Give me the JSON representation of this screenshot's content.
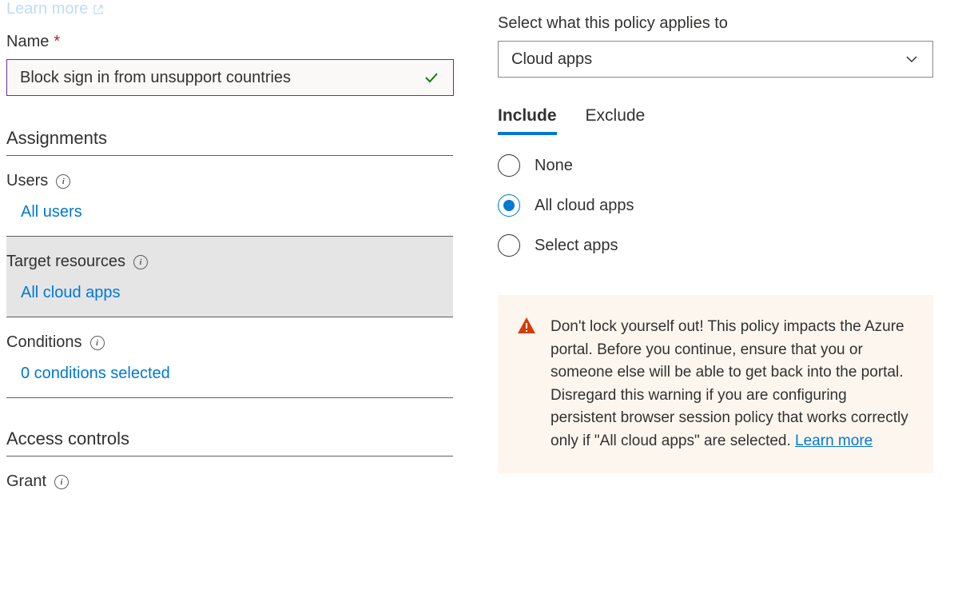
{
  "top_learn_more": "Learn more",
  "name_label": "Name",
  "name_value": "Block sign in from unsupport countries",
  "sections": {
    "assignments": "Assignments",
    "users_label": "Users",
    "users_link": "All users",
    "target_label": "Target resources",
    "target_link": "All cloud apps",
    "conditions_label": "Conditions",
    "conditions_link": "0 conditions selected",
    "access_controls": "Access controls",
    "grant_label": "Grant"
  },
  "right": {
    "select_label": "Select what this policy applies to",
    "dropdown_value": "Cloud apps",
    "tabs": {
      "include": "Include",
      "exclude": "Exclude"
    },
    "radios": {
      "none": "None",
      "all": "All cloud apps",
      "select": "Select apps"
    }
  },
  "warning": {
    "p1": "Don't lock yourself out! This policy impacts the Azure portal. Before you continue, ensure that you or someone else will be able to get back into the portal.",
    "p2a": "Disregard this warning if you are configuring persistent browser session policy that works correctly only if \"All cloud apps\" are selected. ",
    "learn_more": "Learn more"
  }
}
